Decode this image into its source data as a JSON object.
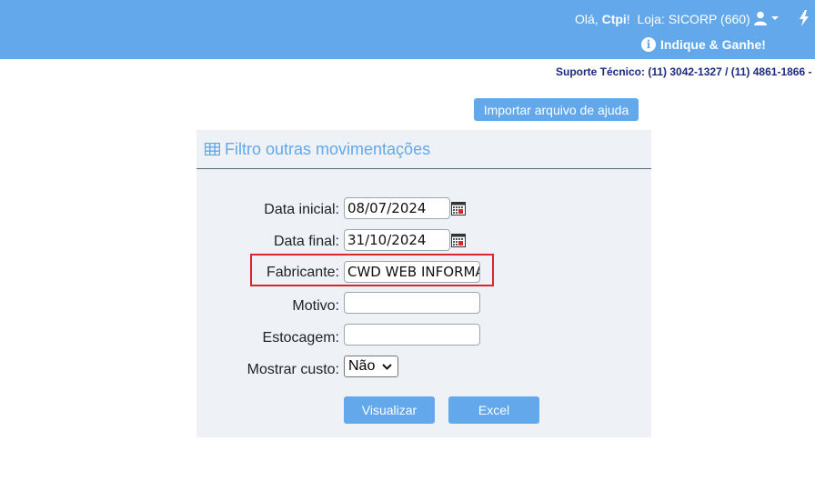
{
  "header": {
    "greeting_prefix": "Olá,",
    "user_name": "Ctpi",
    "greeting_suffix": "!",
    "store": "Loja: SICORP (660)",
    "indique": "Indique & Ganhe!"
  },
  "support": "Suporte Técnico: (11) 3042-1327 / (11) 4861-1866 - ",
  "import_button": "Importar arquivo de ajuda",
  "panel": {
    "title": "Filtro outras movimentações"
  },
  "form": {
    "data_inicial": {
      "label": "Data inicial:",
      "value": "08/07/2024"
    },
    "data_final": {
      "label": "Data final:",
      "value": "31/10/2024"
    },
    "fabricante": {
      "label": "Fabricante:",
      "value": "CWD WEB INFORMA"
    },
    "motivo": {
      "label": "Motivo:",
      "value": ""
    },
    "estocagem": {
      "label": "Estocagem:",
      "value": ""
    },
    "mostrar_custo": {
      "label": "Mostrar custo:",
      "selected": "Não"
    }
  },
  "buttons": {
    "visualizar": "Visualizar",
    "excel": "Excel"
  },
  "colors": {
    "accent": "#62a8ea",
    "highlight": "#d9262a",
    "support_text": "#1b2a80"
  }
}
